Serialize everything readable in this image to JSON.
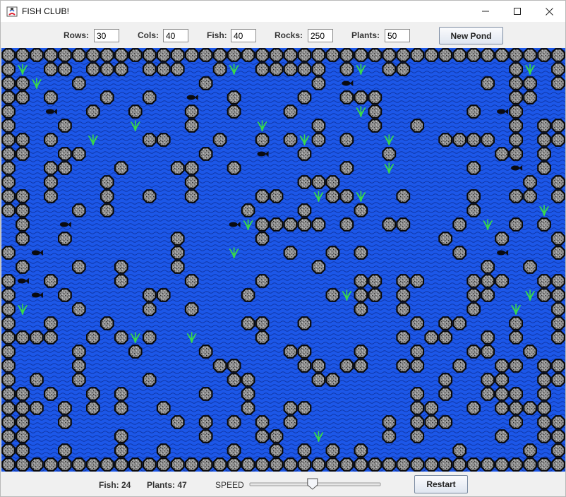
{
  "window": {
    "title": "FISH CLUB!"
  },
  "controls": {
    "rows_label": "Rows:",
    "rows_value": "30",
    "cols_label": "Cols:",
    "cols_value": "40",
    "fish_label": "Fish:",
    "fish_value": "40",
    "rocks_label": "Rocks:",
    "rocks_value": "250",
    "plants_label": "Plants:",
    "plants_value": "50",
    "new_pond_label": "New Pond"
  },
  "status": {
    "fish_count": "Fish: 24",
    "plants_count": "Plants: 47",
    "speed_label": "SPEED",
    "speed_level": 0.48,
    "restart_label": "Restart"
  },
  "pond": {
    "rows": 30,
    "cols": 40,
    "water_color": "#1c57e8",
    "rock_color": "#8f8f8f",
    "plant_color": "#39d84a",
    "fish_color": "#0b0b10",
    "grid": [
      "RRRRRRRRRRRRRRRRRRRRRRRRRRRRRRRRRRRRRRRR",
      "RP.RR.RRR.RRR..RP.RRRRR.RP.RR.......RP.R",
      "RRP..R........R.......R.F.........R.RR.R",
      "RR.R...R..R..F..R....R..RRR.........RR..",
      "R..F..R..R...R..R...R....PR......R.FR...",
      "R...R....P...R....P...R...R..R......R.RR",
      "RR.R..P...RR...R..R.RPR.R..P...RRRR.R.RR",
      "RR..RR........R...F..R.....R.......RR.R.",
      "R..RR...R...RR..R.......R..P.....R..F.R.",
      "R..R...R.....R.......RRR.............R.R",
      "RR.R...R..R..R....RR..PRRP..R....R..RR.R",
      "RR...R.R.........R...R...R.......R....P.",
      ".R..F...........FPRRRRR.R..RR...R.P.R.R.",
      ".R..R.......R.....R............R...R...R",
      "R.F.........R...P...R..R.R......R..F...R",
      ".R...R..R...R.........R...........R..R..",
      "RF.R....R....R....R......RR.RR...RRR..RR",
      "R.F.R.....RR.....R.....RPRR.R....RR..PRR",
      "RP...R....R..R...........R..R....R..P..R",
      "R..R...R.........RR..R.......R.RR...R..R",
      "RRRR..R.RPR..P....R.........R.RR..R.R..R",
      "R....R...R....R.....RR...R...R...RR..R..",
      "R....R.........RR....RR.RR..RR..R..RR.RR",
      "R.R..R....R.....RR....RR.......R..RR..RR",
      "RR.R..R.R.....R..R...........R.R..RRR.R.",
      "RRR.R.R.R..R.....R..RR.......RR..R.RRRR.",
      "RR..R.......R.R.R.R.R......R.RRR....R.RR",
      "RR......R.....R...RR..P....R.R.....R..RR",
      "RR..R...R..R....R..R.R.R.R......R....R.R",
      "RRRRRRRRRRRRRRRRRRRRRRRRRRRRRRRRRRRRRRRR"
    ]
  }
}
